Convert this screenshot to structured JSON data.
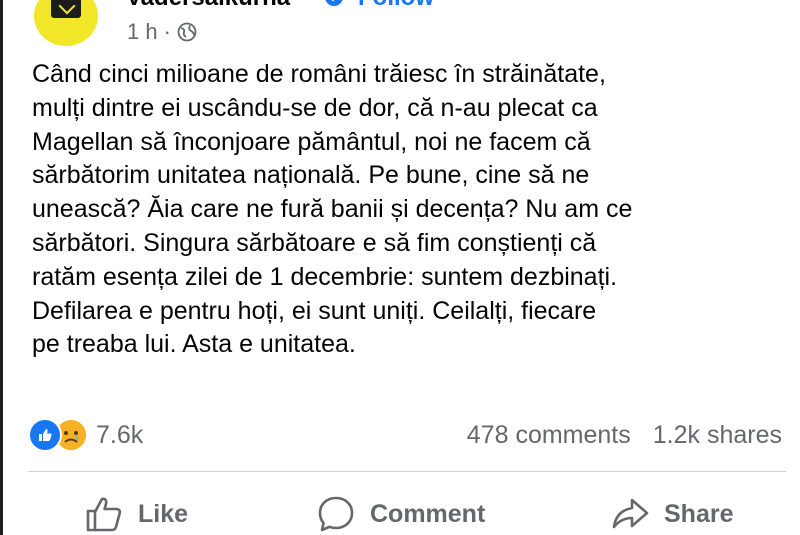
{
  "post": {
    "author": "Vadersalkurna",
    "follow_label": "Follow",
    "time": "1 h",
    "separator": "·",
    "privacy_icon": "globe-icon",
    "text": "Când cinci milioane de români trăiesc în străinătate,\nmulți dintre ei uscându-se de dor, că n-au plecat ca\nMagellan să înconjoare pământul, noi ne facem că\nsărbătorim unitatea națională. Pe bune, cine să ne\nunească? Ăia care ne fură banii și decența? Nu am ce\nsărbători. Singura sărbătoare e să fim conștienți că\nratăm esența zilei de 1 decembrie: suntem dezbinați.\nDefilarea e pentru hoți, ei sunt uniți. Ceilalți, fiecare\npe treaba lui. Asta e unitatea."
  },
  "engagement": {
    "reaction_icons": [
      "like-reaction-icon",
      "sad-reaction-icon"
    ],
    "reaction_count": "7.6k",
    "comments": "478 comments",
    "shares": "1.2k shares"
  },
  "actions": {
    "like_label": "Like",
    "comment_label": "Comment",
    "share_label": "Share"
  },
  "colors": {
    "accent": "#1877f2",
    "secondary_text": "#65676b",
    "avatar_bg": "#f2e629",
    "sad_reaction": "#f7b125"
  }
}
